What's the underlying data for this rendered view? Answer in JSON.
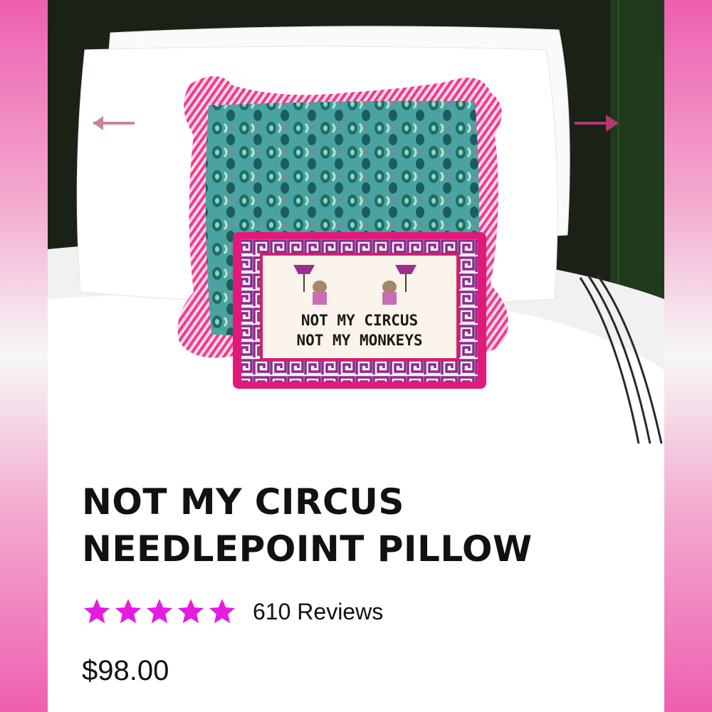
{
  "product": {
    "title_line1": "NOT MY CIRCUS",
    "title_line2": "NEEDLEPOINT PILLOW",
    "rating": 5,
    "rating_max": 5,
    "reviews_label": "610 Reviews",
    "price": "$98.00",
    "pillow_text_line1": "NOT MY CIRCUS",
    "pillow_text_line2": "NOT MY MONKEYS"
  },
  "gallery": {
    "prev_icon": "arrow-left-icon",
    "next_icon": "arrow-right-icon"
  },
  "colors": {
    "star": "#e51ce0",
    "accent_pink": "#e0529f",
    "arrow": "#b2386c"
  }
}
